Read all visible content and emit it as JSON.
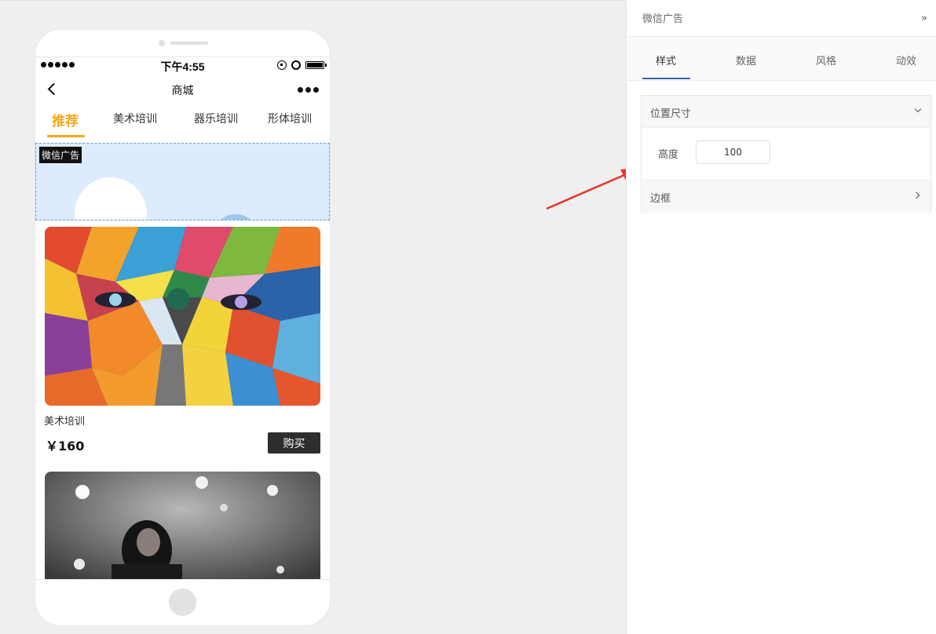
{
  "status_bar": {
    "time": "下午4:55"
  },
  "navbar": {
    "title": "商城"
  },
  "tabs": [
    {
      "label": "推荐",
      "active": true
    },
    {
      "label": "美术培训"
    },
    {
      "label": "器乐培训"
    },
    {
      "label": "形体培训"
    }
  ],
  "ad_component": {
    "label": "微信广告"
  },
  "products": [
    {
      "name": "美术培训",
      "price": "￥160",
      "buy_label": "购买"
    }
  ],
  "panel": {
    "title": "微信广告",
    "tabs": [
      {
        "label": "样式",
        "active": true
      },
      {
        "label": "数据"
      },
      {
        "label": "风格"
      },
      {
        "label": "动效"
      }
    ],
    "sections": {
      "position_size": {
        "title": "位置尺寸",
        "height_label": "高度",
        "height_value": "100"
      },
      "border": {
        "title": "边框"
      }
    }
  },
  "colors": {
    "accent": "#f2a81d",
    "panel_tab_accent": "#3a66b0",
    "annotation_arrow": "#e8332c"
  }
}
